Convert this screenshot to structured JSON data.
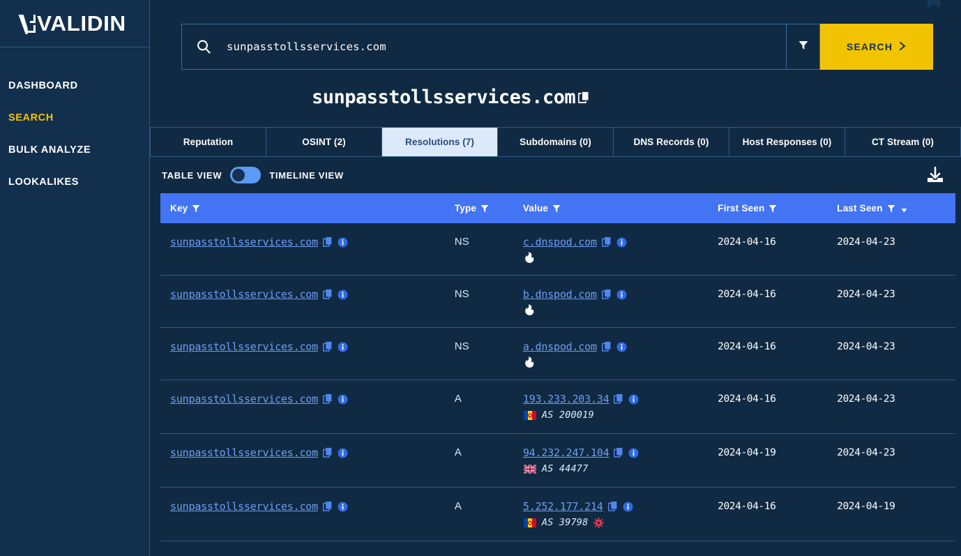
{
  "brand": {
    "name": "VALIDIN",
    "accent_color": "#f2c300"
  },
  "sidebar": {
    "items": [
      {
        "label": "DASHBOARD",
        "active": false
      },
      {
        "label": "SEARCH",
        "active": true
      },
      {
        "label": "BULK ANALYZE",
        "active": false
      },
      {
        "label": "LOOKALIKES",
        "active": false
      }
    ]
  },
  "search": {
    "value": "sunpasstollsservices.com",
    "placeholder": "Search",
    "button_label": "SEARCH",
    "icon": "search-icon",
    "filter_icon": "filter-funnel-icon"
  },
  "page": {
    "title": "sunpasstollsservices.com",
    "copy_icon": "copy-icon"
  },
  "tabs": [
    {
      "label": "Reputation",
      "active": false
    },
    {
      "label": "OSINT (2)",
      "active": false
    },
    {
      "label": "Resolutions (7)",
      "active": true
    },
    {
      "label": "Subdomains (0)",
      "active": false
    },
    {
      "label": "DNS Records (0)",
      "active": false
    },
    {
      "label": "Host Responses (0)",
      "active": false
    },
    {
      "label": "CT Stream (0)",
      "active": false
    }
  ],
  "view_toggle": {
    "left_label": "TABLE VIEW",
    "right_label": "TIMELINE VIEW",
    "selected": "TABLE VIEW"
  },
  "download": {
    "icon": "download-icon"
  },
  "table": {
    "columns": [
      {
        "label": "Key",
        "filter": true,
        "sort": false
      },
      {
        "label": "Type",
        "filter": true,
        "sort": false
      },
      {
        "label": "Value",
        "filter": true,
        "sort": false
      },
      {
        "label": "First Seen",
        "filter": true,
        "sort": false
      },
      {
        "label": "Last Seen",
        "filter": true,
        "sort": true
      }
    ],
    "header_color": "#4274f3",
    "rows": [
      {
        "key": "sunpasstollsservices.com",
        "type": "NS",
        "value": "c.dnspod.com",
        "sub_icon": "flame-icon",
        "sub_flag": "",
        "sub_text": "",
        "sub_warn": "",
        "first_seen": "2024-04-16",
        "last_seen": "2024-04-23"
      },
      {
        "key": "sunpasstollsservices.com",
        "type": "NS",
        "value": "b.dnspod.com",
        "sub_icon": "flame-icon",
        "sub_flag": "",
        "sub_text": "",
        "sub_warn": "",
        "first_seen": "2024-04-16",
        "last_seen": "2024-04-23"
      },
      {
        "key": "sunpasstollsservices.com",
        "type": "NS",
        "value": "a.dnspod.com",
        "sub_icon": "flame-icon",
        "sub_flag": "",
        "sub_text": "",
        "sub_warn": "",
        "first_seen": "2024-04-16",
        "last_seen": "2024-04-23"
      },
      {
        "key": "sunpasstollsservices.com",
        "type": "A",
        "value": "193.233.203.34",
        "sub_icon": "",
        "sub_flag": "MD",
        "sub_text": "AS 200019",
        "sub_warn": "",
        "first_seen": "2024-04-16",
        "last_seen": "2024-04-23"
      },
      {
        "key": "sunpasstollsservices.com",
        "type": "A",
        "value": "94.232.247.104",
        "sub_icon": "",
        "sub_flag": "GB",
        "sub_text": "AS 44477",
        "sub_warn": "",
        "first_seen": "2024-04-19",
        "last_seen": "2024-04-23"
      },
      {
        "key": "sunpasstollsservices.com",
        "type": "A",
        "value": "5.252.177.214",
        "sub_icon": "",
        "sub_flag": "MD",
        "sub_text": "AS 39798",
        "sub_warn": "malicious-gear-icon",
        "first_seen": "2024-04-16",
        "last_seen": "2024-04-19"
      }
    ]
  }
}
